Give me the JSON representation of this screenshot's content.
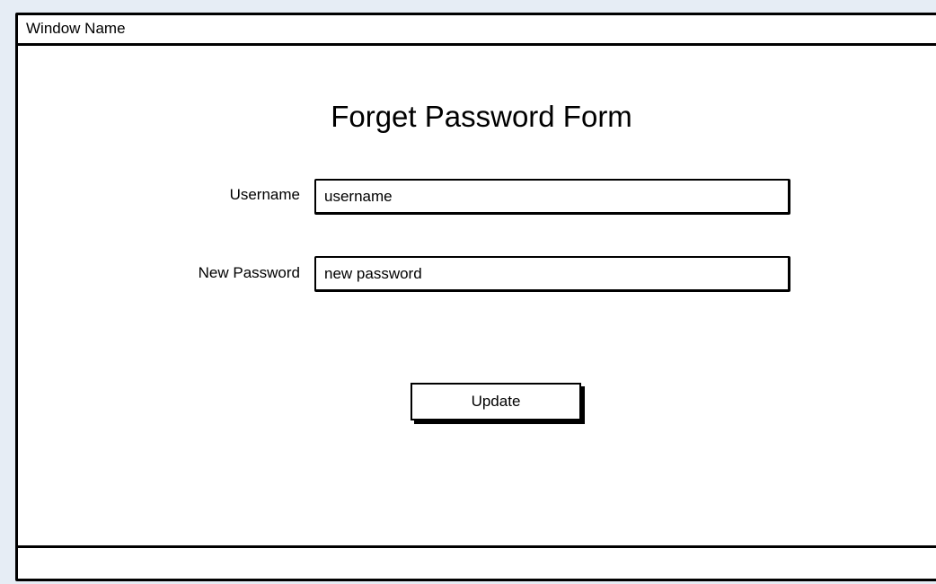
{
  "window": {
    "title": "Window Name"
  },
  "form": {
    "title": "Forget Password Form",
    "username_label": "Username",
    "username_value": "username",
    "new_password_label": "New Password",
    "new_password_value": "new password",
    "update_button": "Update"
  },
  "colors": {
    "page_background": "#e6edf5",
    "window_background": "#ffffff",
    "stroke": "#000000"
  }
}
